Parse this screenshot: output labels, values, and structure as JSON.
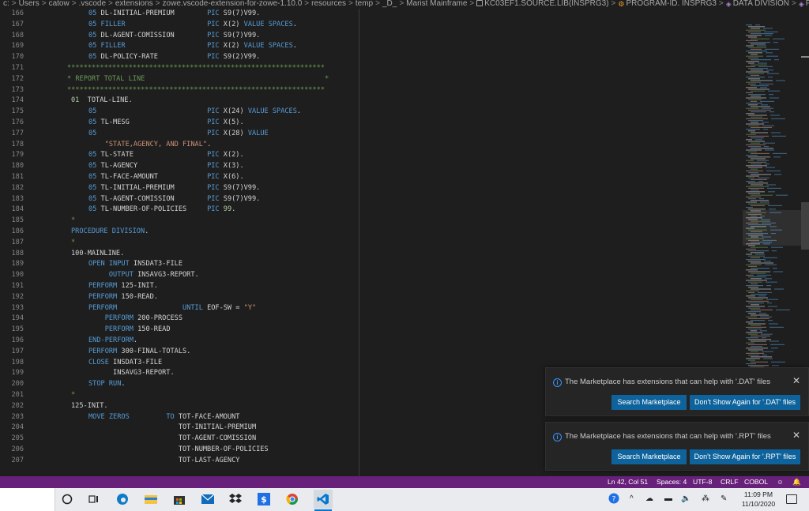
{
  "breadcrumb": [
    {
      "label": "c:",
      "icon": null
    },
    {
      "label": "Users",
      "icon": null
    },
    {
      "label": "catow",
      "icon": null
    },
    {
      "label": ".vscode",
      "icon": null
    },
    {
      "label": "extensions",
      "icon": null
    },
    {
      "label": "zowe.vscode-extension-for-zowe-1.10.0",
      "icon": null
    },
    {
      "label": "resources",
      "icon": null
    },
    {
      "label": "temp",
      "icon": null
    },
    {
      "label": "_D_",
      "icon": null
    },
    {
      "label": "Marist Mainframe",
      "icon": null
    },
    {
      "label": "KC03EF1.SOURCE.LIB(INSPRG3)",
      "icon": "file-icon"
    },
    {
      "label": "PROGRAM-ID. INSPRG3",
      "icon": "dna-icon"
    },
    {
      "label": "DATA DIVISION",
      "icon": "cube-icon"
    },
    {
      "label": "FILE SECTION",
      "icon": "cube-icon"
    }
  ],
  "editor": {
    "lines": [
      {
        "n": "166",
        "segs": [
          [
            "kw",
            "05"
          ],
          [
            "t",
            " DL-INITIAL-PREMIUM        "
          ],
          [
            "kw",
            "PIC"
          ],
          [
            "t",
            " S9(7)V99."
          ]
        ]
      },
      {
        "n": "167",
        "segs": [
          [
            "kw",
            "05"
          ],
          [
            "t",
            " "
          ],
          [
            "kw",
            "FILLER"
          ],
          [
            "t",
            "                    "
          ],
          [
            "kw",
            "PIC"
          ],
          [
            "t",
            " X(2) "
          ],
          [
            "kw",
            "VALUE SPACES"
          ],
          [
            "t",
            "."
          ]
        ]
      },
      {
        "n": "168",
        "segs": [
          [
            "kw",
            "05"
          ],
          [
            "t",
            " DL-AGENT-COMISSION        "
          ],
          [
            "kw",
            "PIC"
          ],
          [
            "t",
            " S9(7)V99."
          ]
        ]
      },
      {
        "n": "169",
        "segs": [
          [
            "kw",
            "05"
          ],
          [
            "t",
            " "
          ],
          [
            "kw",
            "FILLER"
          ],
          [
            "t",
            "                    "
          ],
          [
            "kw",
            "PIC"
          ],
          [
            "t",
            " X(2) "
          ],
          [
            "kw",
            "VALUE SPACES"
          ],
          [
            "t",
            "."
          ]
        ]
      },
      {
        "n": "170",
        "segs": [
          [
            "kw",
            "05"
          ],
          [
            "t",
            " DL-POLICY-RATE            "
          ],
          [
            "kw",
            "PIC"
          ],
          [
            "t",
            " S9(2)V99."
          ]
        ]
      },
      {
        "n": "171",
        "stars": true,
        "segs": [
          [
            "cm",
            "***************************************************************"
          ]
        ]
      },
      {
        "n": "172",
        "stars": true,
        "segs": [
          [
            "cm",
            "* REPORT TOTAL LINE                                            *"
          ]
        ]
      },
      {
        "n": "173",
        "stars": true,
        "segs": [
          [
            "cm",
            "***************************************************************"
          ]
        ]
      },
      {
        "n": "174",
        "segs": [
          [
            "num",
            "01"
          ],
          [
            "t",
            "  TOTAL-LINE."
          ]
        ],
        "shift": -22
      },
      {
        "n": "175",
        "segs": [
          [
            "kw",
            "05"
          ],
          [
            "t",
            "                           "
          ],
          [
            "kw",
            "PIC"
          ],
          [
            "t",
            " X(24) "
          ],
          [
            "kw",
            "VALUE SPACES"
          ],
          [
            "t",
            "."
          ]
        ]
      },
      {
        "n": "176",
        "segs": [
          [
            "kw",
            "05"
          ],
          [
            "t",
            " TL-MESG                   "
          ],
          [
            "kw",
            "PIC"
          ],
          [
            "t",
            " X(5)."
          ]
        ]
      },
      {
        "n": "177",
        "segs": [
          [
            "kw",
            "05"
          ],
          [
            "t",
            "                           "
          ],
          [
            "kw",
            "PIC"
          ],
          [
            "t",
            " X(28) "
          ],
          [
            "kw",
            "VALUE"
          ]
        ]
      },
      {
        "n": "178",
        "segs": [
          [
            "t",
            "    "
          ],
          [
            "str",
            "\"STATE,AGENCY, AND FINAL\""
          ],
          [
            "t",
            "."
          ]
        ]
      },
      {
        "n": "179",
        "segs": [
          [
            "kw",
            "05"
          ],
          [
            "t",
            " TL-STATE                  "
          ],
          [
            "kw",
            "PIC"
          ],
          [
            "t",
            " X(2)."
          ]
        ]
      },
      {
        "n": "180",
        "segs": [
          [
            "kw",
            "05"
          ],
          [
            "t",
            " TL-AGENCY                 "
          ],
          [
            "kw",
            "PIC"
          ],
          [
            "t",
            " X(3)."
          ]
        ]
      },
      {
        "n": "181",
        "segs": [
          [
            "kw",
            "05"
          ],
          [
            "t",
            " TL-FACE-AMOUNT            "
          ],
          [
            "kw",
            "PIC"
          ],
          [
            "t",
            " X(6)."
          ]
        ]
      },
      {
        "n": "182",
        "segs": [
          [
            "kw",
            "05"
          ],
          [
            "t",
            " TL-INITIAL-PREMIUM        "
          ],
          [
            "kw",
            "PIC"
          ],
          [
            "t",
            " S9(7)V99."
          ]
        ]
      },
      {
        "n": "183",
        "segs": [
          [
            "kw",
            "05"
          ],
          [
            "t",
            " TL-AGENT-COMISSION        "
          ],
          [
            "kw",
            "PIC"
          ],
          [
            "t",
            " S9(7)V99."
          ]
        ]
      },
      {
        "n": "184",
        "segs": [
          [
            "kw",
            "05"
          ],
          [
            "t",
            " TL-NUMBER-OF-POLICIES     "
          ],
          [
            "kw",
            "PIC"
          ],
          [
            "t",
            " "
          ],
          [
            "num",
            "99"
          ],
          [
            "t",
            "."
          ]
        ]
      },
      {
        "n": "185",
        "segs": [
          [
            "cm",
            "*"
          ]
        ],
        "shift": -22
      },
      {
        "n": "186",
        "segs": [
          [
            "kw",
            "PROCEDURE DIVISION"
          ],
          [
            "t",
            "."
          ]
        ],
        "shift": -22
      },
      {
        "n": "187",
        "segs": [
          [
            "cm",
            "*"
          ]
        ],
        "shift": -22
      },
      {
        "n": "188",
        "segs": [
          [
            "t",
            "100-MAINLINE."
          ]
        ],
        "shift": -22
      },
      {
        "n": "189",
        "segs": [
          [
            "kw",
            "OPEN INPUT"
          ],
          [
            "t",
            " INSDAT3-FILE"
          ]
        ]
      },
      {
        "n": "190",
        "segs": [
          [
            "t",
            "     "
          ],
          [
            "kw",
            "OUTPUT"
          ],
          [
            "t",
            " INSAVG3-REPORT."
          ]
        ]
      },
      {
        "n": "191",
        "segs": [
          [
            "kw",
            "PERFORM"
          ],
          [
            "t",
            " 125-INIT."
          ]
        ]
      },
      {
        "n": "192",
        "segs": [
          [
            "kw",
            "PERFORM"
          ],
          [
            "t",
            " 150-READ."
          ]
        ]
      },
      {
        "n": "193",
        "segs": [
          [
            "kw",
            "PERFORM"
          ],
          [
            "t",
            "                "
          ],
          [
            "kw",
            "UNTIL"
          ],
          [
            "t",
            " EOF-SW = "
          ],
          [
            "str",
            "\"Y\""
          ]
        ]
      },
      {
        "n": "194",
        "segs": [
          [
            "t",
            "    "
          ],
          [
            "kw",
            "PERFORM"
          ],
          [
            "t",
            " 200-PROCESS"
          ]
        ]
      },
      {
        "n": "195",
        "segs": [
          [
            "t",
            "    "
          ],
          [
            "kw",
            "PERFORM"
          ],
          [
            "t",
            " 150-READ"
          ]
        ]
      },
      {
        "n": "196",
        "segs": [
          [
            "kw",
            "END-PERFORM"
          ],
          [
            "t",
            "."
          ]
        ]
      },
      {
        "n": "197",
        "segs": [
          [
            "kw",
            "PERFORM"
          ],
          [
            "t",
            " 300-FINAL-TOTALS."
          ]
        ]
      },
      {
        "n": "198",
        "segs": [
          [
            "kw",
            "CLOSE"
          ],
          [
            "t",
            " INSDAT3-FILE"
          ]
        ]
      },
      {
        "n": "199",
        "segs": [
          [
            "t",
            "      INSAVG3-REPORT."
          ]
        ]
      },
      {
        "n": "200",
        "segs": [
          [
            "kw",
            "STOP RUN"
          ],
          [
            "t",
            "."
          ]
        ]
      },
      {
        "n": "201",
        "segs": [
          [
            "cm",
            "*"
          ]
        ],
        "shift": -22
      },
      {
        "n": "202",
        "segs": [
          [
            "t",
            "125-INIT."
          ]
        ],
        "shift": -22
      },
      {
        "n": "203",
        "segs": [
          [
            "kw",
            "MOVE ZEROS"
          ],
          [
            "t",
            "         "
          ],
          [
            "kw",
            "TO"
          ],
          [
            "t",
            " TOT-FACE-AMOUNT"
          ]
        ]
      },
      {
        "n": "204",
        "segs": [
          [
            "t",
            "                      TOT-INITIAL-PREMIUM"
          ]
        ]
      },
      {
        "n": "205",
        "segs": [
          [
            "t",
            "                      TOT-AGENT-COMISSION"
          ]
        ]
      },
      {
        "n": "206",
        "segs": [
          [
            "t",
            "                      TOT-NUMBER-OF-POLICIES"
          ]
        ]
      },
      {
        "n": "207",
        "segs": [
          [
            "t",
            "                      TOT-LAST-AGENCY"
          ]
        ]
      }
    ]
  },
  "notifications": [
    {
      "message": "The Marketplace has extensions that can help with '.DAT' files",
      "primary": "Search Marketplace",
      "secondary": "Don't Show Again for '.DAT' files"
    },
    {
      "message": "The Marketplace has extensions that can help with '.RPT' files",
      "primary": "Search Marketplace",
      "secondary": "Don't Show Again for '.RPT' files"
    }
  ],
  "statusbar": {
    "position": "Ln 42, Col 51",
    "spaces": "Spaces: 4",
    "encoding": "UTF-8",
    "eol": "CRLF",
    "language": "COBOL"
  },
  "taskbar": {
    "time": "11:09 PM",
    "date": "11/10/2020"
  },
  "colors": {
    "statusbar": "#68217a",
    "button": "#0e639c",
    "keyword": "#569cd6",
    "comment": "#6a9955",
    "string": "#ce9178"
  }
}
